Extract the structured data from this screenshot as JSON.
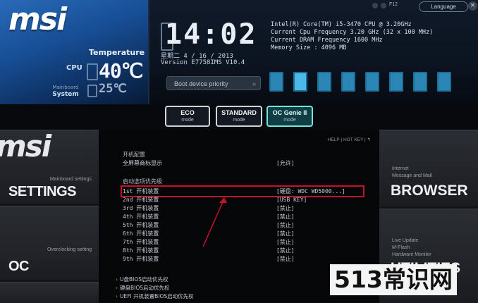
{
  "header": {
    "logo": "msi",
    "temperature_title": "Temperature",
    "cpu_label": "CPU",
    "cpu_temp": "40℃",
    "system_label_small": "Mainboard",
    "system_label": "System",
    "system_temp": "25℃",
    "time": "14:02",
    "date": "星期二  4 / 16 / 2013",
    "version": "Version E7758IMS V10.4",
    "sysinfo": [
      "Intel(R) Core(TM) i5-3470 CPU @ 3.20GHz",
      "Current Cpu Frequency 3.20 GHz (32 x 100 MHz)",
      "Current DRAM Frequency 1600 MHz",
      "Memory Size : 4096 MB"
    ],
    "boot_priority_label": "Boot device priority",
    "f12_label": "F12",
    "language_button": "Language",
    "close_glyph": "×"
  },
  "modes": [
    {
      "title": "ECO",
      "sub": "mode"
    },
    {
      "title": "STANDARD",
      "sub": "mode"
    },
    {
      "title": "OC Genie II",
      "sub": "mode"
    }
  ],
  "left_panels": {
    "settings_sub": "Mainboard settings",
    "settings_big": "SETTINGS",
    "oc_sub": "Overclocking setting",
    "oc_big": "OC"
  },
  "right_panels": {
    "browser_sub1": "Internet",
    "browser_sub2": "Message and Mail",
    "browser_big": "BROWSER",
    "utilities_sub1": "Live Update",
    "utilities_sub2": "M-Flash",
    "utilities_sub3": "Hardware Monitor",
    "utilities_big": "UTILITIES"
  },
  "center": {
    "helpbar": "HELP  |  HOT KEY  |  ↰",
    "section1": "开机配置",
    "fullscreen_label": "全屏幕商标显示",
    "fullscreen_value": "[允许]",
    "section2": "启动选项优先级",
    "boot_rows": [
      {
        "k": "1st 开机装置",
        "v": "[硬盘: WDC WD5000...]"
      },
      {
        "k": "2nd 开机装置",
        "v": "[USB KEY]"
      },
      {
        "k": "3rd 开机装置",
        "v": "[禁止]"
      },
      {
        "k": "4th 开机装置",
        "v": "[禁止]"
      },
      {
        "k": "5th 开机装置",
        "v": "[禁止]"
      },
      {
        "k": "6th 开机装置",
        "v": "[禁止]"
      },
      {
        "k": "7th 开机装置",
        "v": "[禁止]"
      },
      {
        "k": "8th 开机装置",
        "v": "[禁止]"
      },
      {
        "k": "9th 开机装置",
        "v": "[禁止]"
      }
    ],
    "links": [
      "U盘BIOS启动优先权",
      "硬盘BIOS启动优先权",
      "UEFI 开机装置BIOS启动优先权"
    ]
  },
  "watermark": "513常识网",
  "colors": {
    "accent": "#6fe6e0",
    "highlight": "#c0142a",
    "brand_blue": "#174e95"
  }
}
